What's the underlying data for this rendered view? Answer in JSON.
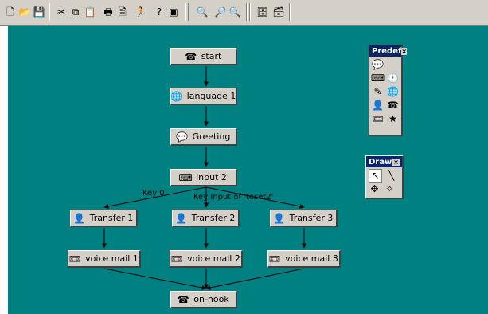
{
  "toolbar": {
    "buttons": [
      {
        "name": "new-file-icon",
        "glyph": "🗋"
      },
      {
        "name": "open-folder-icon",
        "glyph": "📂"
      },
      {
        "name": "save-icon",
        "glyph": "💾"
      },
      {
        "name": "cut-icon",
        "glyph": "✂"
      },
      {
        "name": "copy-icon",
        "glyph": "⧉"
      },
      {
        "name": "paste-icon",
        "glyph": "📋"
      },
      {
        "name": "print-icon",
        "glyph": "🖶"
      },
      {
        "name": "print-preview-icon",
        "glyph": "🗎"
      },
      {
        "name": "run-icon",
        "glyph": "🏃"
      },
      {
        "name": "help-icon",
        "glyph": "?"
      },
      {
        "name": "properties-icon",
        "glyph": "▣"
      },
      {
        "name": "find-icon",
        "glyph": "🔍"
      },
      {
        "name": "zoom-in-icon",
        "glyph": "🔎"
      },
      {
        "name": "zoom-out-icon",
        "glyph": "🔍"
      },
      {
        "name": "database-icon",
        "glyph": "🗄"
      },
      {
        "name": "export-icon",
        "glyph": "🗃"
      }
    ]
  },
  "flow": {
    "nodes": [
      {
        "id": "start",
        "label": "start",
        "icon": "phone-icon",
        "glyph": "☎"
      },
      {
        "id": "language1",
        "label": "language 1",
        "icon": "globe-icon",
        "glyph": "🌐"
      },
      {
        "id": "greeting",
        "label": "Greeting",
        "icon": "greeting-icon",
        "glyph": "💬"
      },
      {
        "id": "input2",
        "label": "input 2",
        "icon": "keypad-icon",
        "glyph": "⌨"
      },
      {
        "id": "transfer1",
        "label": "Transfer 1",
        "icon": "transfer-icon",
        "glyph": "👤"
      },
      {
        "id": "transfer2",
        "label": "Transfer 2",
        "icon": "transfer-icon",
        "glyph": "👤"
      },
      {
        "id": "transfer3",
        "label": "Transfer 3",
        "icon": "transfer-icon",
        "glyph": "👤"
      },
      {
        "id": "voicemail1",
        "label": "voice mail 1",
        "icon": "voice-mail-icon",
        "glyph": "📼"
      },
      {
        "id": "voicemail2",
        "label": "voice mail 2",
        "icon": "voice-mail-icon",
        "glyph": "📼"
      },
      {
        "id": "voicemail3",
        "label": "voice mail 3",
        "icon": "voice-mail-icon",
        "glyph": "📼"
      },
      {
        "id": "onhook",
        "label": "on-hook",
        "icon": "telephone-icon",
        "glyph": "☎"
      }
    ],
    "edge_labels": {
      "key0": "Key 0",
      "key_input": "Key Input of 'teset2'"
    }
  },
  "palettes": {
    "predef": {
      "title": "Predef",
      "close": "×",
      "rows": [
        [
          {
            "name": "greeting-tool-icon",
            "glyph": "💬"
          }
        ],
        [
          {
            "name": "input-tool-icon",
            "glyph": "⌨"
          },
          {
            "name": "clock-tool-icon",
            "glyph": "🕐"
          }
        ],
        [
          {
            "name": "script-tool-icon",
            "glyph": "✎"
          },
          {
            "name": "language-tool-icon",
            "glyph": "🌐"
          }
        ],
        [
          {
            "name": "transfer-tool-icon",
            "glyph": "👤"
          },
          {
            "name": "phone-tool-icon",
            "glyph": "☎"
          }
        ],
        [
          {
            "name": "voice-mail-tool-icon",
            "glyph": "📼"
          },
          {
            "name": "star-tool-icon",
            "glyph": "★"
          }
        ]
      ]
    },
    "draw": {
      "title": "Draw",
      "close": "×",
      "rows": [
        [
          {
            "name": "pointer-tool-icon",
            "glyph": "↖"
          },
          {
            "name": "line-tool-icon",
            "glyph": "╲"
          }
        ],
        [
          {
            "name": "move-tool-icon",
            "glyph": "✥"
          },
          {
            "name": "shape-tool-icon",
            "glyph": "✧"
          }
        ]
      ]
    }
  }
}
